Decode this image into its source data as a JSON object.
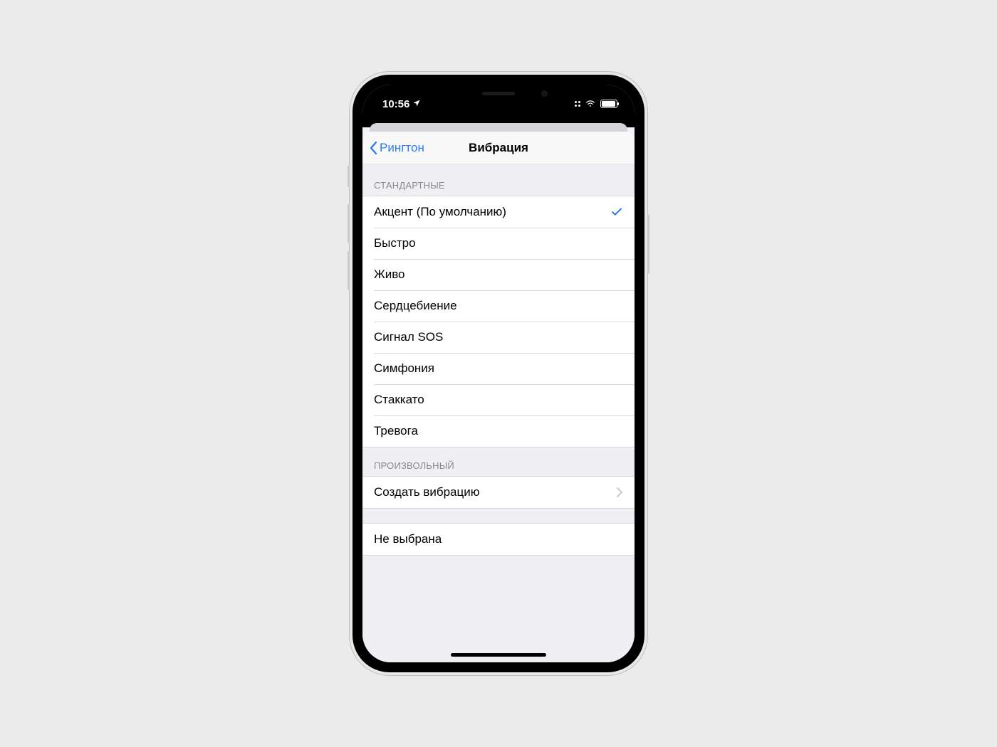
{
  "statusbar": {
    "time": "10:56"
  },
  "nav": {
    "back_label": "Рингтон",
    "title": "Вибрация"
  },
  "sections": {
    "standard": {
      "header": "СТАНДАРТНЫЕ",
      "items": [
        {
          "label": "Акцент (По умолчанию)",
          "selected": true
        },
        {
          "label": "Быстро",
          "selected": false
        },
        {
          "label": "Живо",
          "selected": false
        },
        {
          "label": "Сердцебиение",
          "selected": false
        },
        {
          "label": "Сигнал SOS",
          "selected": false
        },
        {
          "label": "Симфония",
          "selected": false
        },
        {
          "label": "Стаккато",
          "selected": false
        },
        {
          "label": "Тревога",
          "selected": false
        }
      ]
    },
    "custom": {
      "header": "ПРОИЗВОЛЬНЫЙ",
      "create_label": "Создать вибрацию"
    },
    "none": {
      "label": "Не выбрана"
    }
  }
}
